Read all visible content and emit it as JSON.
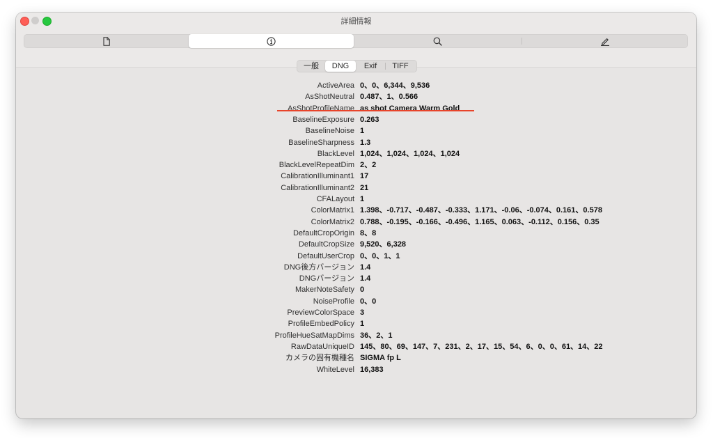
{
  "window": {
    "title": "詳細情報"
  },
  "toolbar": {
    "segments": [
      {
        "icon": "document-icon"
      },
      {
        "icon": "info-icon"
      },
      {
        "icon": "search-icon"
      },
      {
        "icon": "pencil-icon"
      }
    ],
    "active_segment": 1
  },
  "tabs": {
    "items": [
      "一般",
      "DNG",
      "Exif",
      "TIFF"
    ],
    "active": "DNG"
  },
  "highlight_color": "#e8442a",
  "rows": [
    {
      "key": "ActiveArea",
      "value": "0、0、6,344、9,536"
    },
    {
      "key": "AsShotNeutral",
      "value": "0.487、1、0.566"
    },
    {
      "key": "AsShotProfileName",
      "value": "as shot Camera Warm Gold"
    },
    {
      "key": "BaselineExposure",
      "value": "0.263"
    },
    {
      "key": "BaselineNoise",
      "value": "1"
    },
    {
      "key": "BaselineSharpness",
      "value": "1.3"
    },
    {
      "key": "BlackLevel",
      "value": "1,024、1,024、1,024、1,024"
    },
    {
      "key": "BlackLevelRepeatDim",
      "value": "2、2"
    },
    {
      "key": "CalibrationIlluminant1",
      "value": "17"
    },
    {
      "key": "CalibrationIlluminant2",
      "value": "21"
    },
    {
      "key": "CFALayout",
      "value": "1"
    },
    {
      "key": "ColorMatrix1",
      "value": "1.398、-0.717、-0.487、-0.333、1.171、-0.06、-0.074、0.161、0.578"
    },
    {
      "key": "ColorMatrix2",
      "value": "0.788、-0.195、-0.166、-0.496、1.165、0.063、-0.112、0.156、0.35"
    },
    {
      "key": "DefaultCropOrigin",
      "value": "8、8"
    },
    {
      "key": "DefaultCropSize",
      "value": "9,520、6,328"
    },
    {
      "key": "DefaultUserCrop",
      "value": "0、0、1、1"
    },
    {
      "key": "DNG後方バージョン",
      "value": "1.4"
    },
    {
      "key": "DNGバージョン",
      "value": "1.4"
    },
    {
      "key": "MakerNoteSafety",
      "value": "0"
    },
    {
      "key": "NoiseProfile",
      "value": "0、0"
    },
    {
      "key": "PreviewColorSpace",
      "value": "3"
    },
    {
      "key": "ProfileEmbedPolicy",
      "value": "1"
    },
    {
      "key": "ProfileHueSatMapDims",
      "value": "36、2、1"
    },
    {
      "key": "RawDataUniqueID",
      "value": "145、80、69、147、7、231、2、17、15、54、6、0、0、61、14、22"
    },
    {
      "key": "カメラの固有機種名",
      "value": "SIGMA fp L"
    },
    {
      "key": "WhiteLevel",
      "value": "16,383"
    }
  ]
}
